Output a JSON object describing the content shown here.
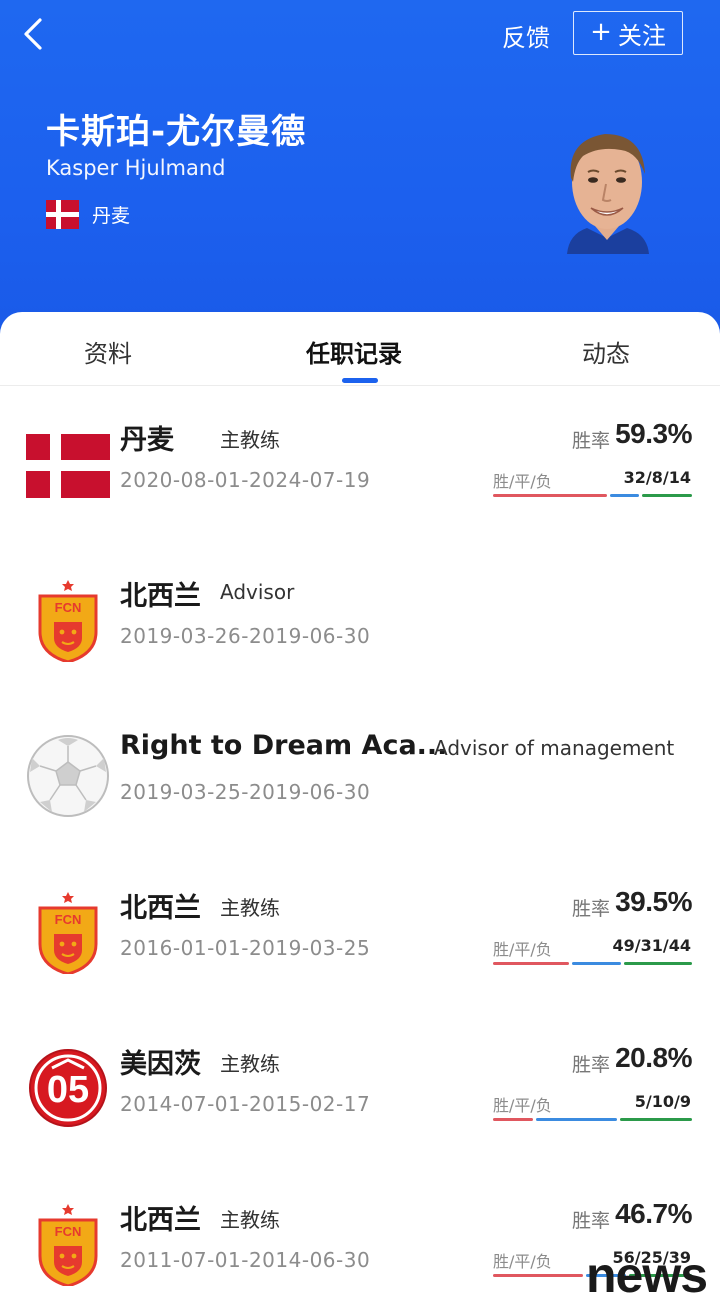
{
  "header": {
    "feedback_label": "反馈",
    "follow_plus": "+",
    "follow_label": "关注",
    "name_cn": "卡斯珀-尤尔曼德",
    "name_en": "Kasper Hjulmand",
    "nationality": "丹麦"
  },
  "tabs": [
    {
      "label": "资料"
    },
    {
      "label": "任职记录",
      "active": true
    },
    {
      "label": "动态"
    }
  ],
  "records": [
    {
      "club": "丹麦",
      "role": "主教练",
      "dates": "2020-08-01-2024-07-19",
      "logo": "denmark-flag",
      "winrate_label": "胜率",
      "winrate": "59.3%",
      "wdl_label": "胜/平/负",
      "wdl": "32/8/14",
      "wins": 32,
      "draws": 8,
      "losses": 14
    },
    {
      "club": "北西兰",
      "role": "Advisor",
      "dates": "2019-03-26-2019-06-30",
      "logo": "nordsjaelland-crest"
    },
    {
      "club": "Right to Dream Aca...",
      "role": "Advisor of management",
      "dates": "2019-03-25-2019-06-30",
      "logo": "football-icon"
    },
    {
      "club": "北西兰",
      "role": "主教练",
      "dates": "2016-01-01-2019-03-25",
      "logo": "nordsjaelland-crest",
      "winrate_label": "胜率",
      "winrate": "39.5%",
      "wdl_label": "胜/平/负",
      "wdl": "49/31/44",
      "wins": 49,
      "draws": 31,
      "losses": 44
    },
    {
      "club": "美因茨",
      "role": "主教练",
      "dates": "2014-07-01-2015-02-17",
      "logo": "mainz-05-crest",
      "winrate_label": "胜率",
      "winrate": "20.8%",
      "wdl_label": "胜/平/负",
      "wdl": "5/10/9",
      "wins": 5,
      "draws": 10,
      "losses": 9
    },
    {
      "club": "北西兰",
      "role": "主教练",
      "dates": "2011-07-01-2014-06-30",
      "logo": "nordsjaelland-crest",
      "winrate_label": "胜率",
      "winrate": "46.7%",
      "wdl_label": "胜/平/负",
      "wdl": "56/25/39",
      "wins": 56,
      "draws": 25,
      "losses": 39
    }
  ],
  "colors": {
    "header_blue": "#1c60ee",
    "win": "#e0575f",
    "draw": "#3b8be0",
    "loss": "#2b9a4a",
    "denmark_red": "#c8102e"
  },
  "watermark": "news"
}
